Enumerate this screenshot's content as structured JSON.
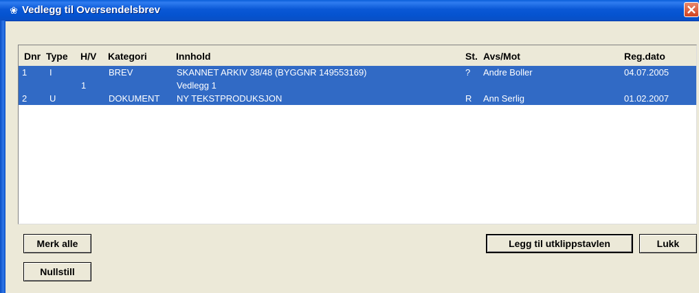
{
  "window": {
    "title": "Vedlegg til Oversendelsbrev",
    "icon": "app-icon",
    "close_icon": "close-icon"
  },
  "table": {
    "headers": {
      "dnr": "Dnr",
      "type": "Type",
      "hv": "H/V",
      "kategori": "Kategori",
      "innhold": "Innhold",
      "st": "St.",
      "avsmot": "Avs/Mot",
      "regdato": "Reg.dato"
    },
    "rows": [
      {
        "dnr": "1",
        "type": "I",
        "hv": "",
        "kategori": "BREV",
        "innhold": "SKANNET ARKIV 38/48 (BYGGNR 149553169)",
        "st": "?",
        "avsmot": "Andre Boller",
        "regdato": "04.07.2005"
      },
      {
        "dnr": "",
        "type": "",
        "hv": "1",
        "kategori": "",
        "innhold": "Vedlegg 1",
        "st": "",
        "avsmot": "",
        "regdato": ""
      },
      {
        "dnr": "2",
        "type": "U",
        "hv": "",
        "kategori": "DOKUMENT",
        "innhold": "NY TEKSTPRODUKSJON",
        "st": "R",
        "avsmot": "Ann Serlig",
        "regdato": "01.02.2007"
      }
    ],
    "selection_color": "#316ac5"
  },
  "buttons": {
    "merk_alle": "Merk alle",
    "nullstill": "Nullstill",
    "legg_til": "Legg til utklippstavlen",
    "lukk": "Lukk"
  }
}
